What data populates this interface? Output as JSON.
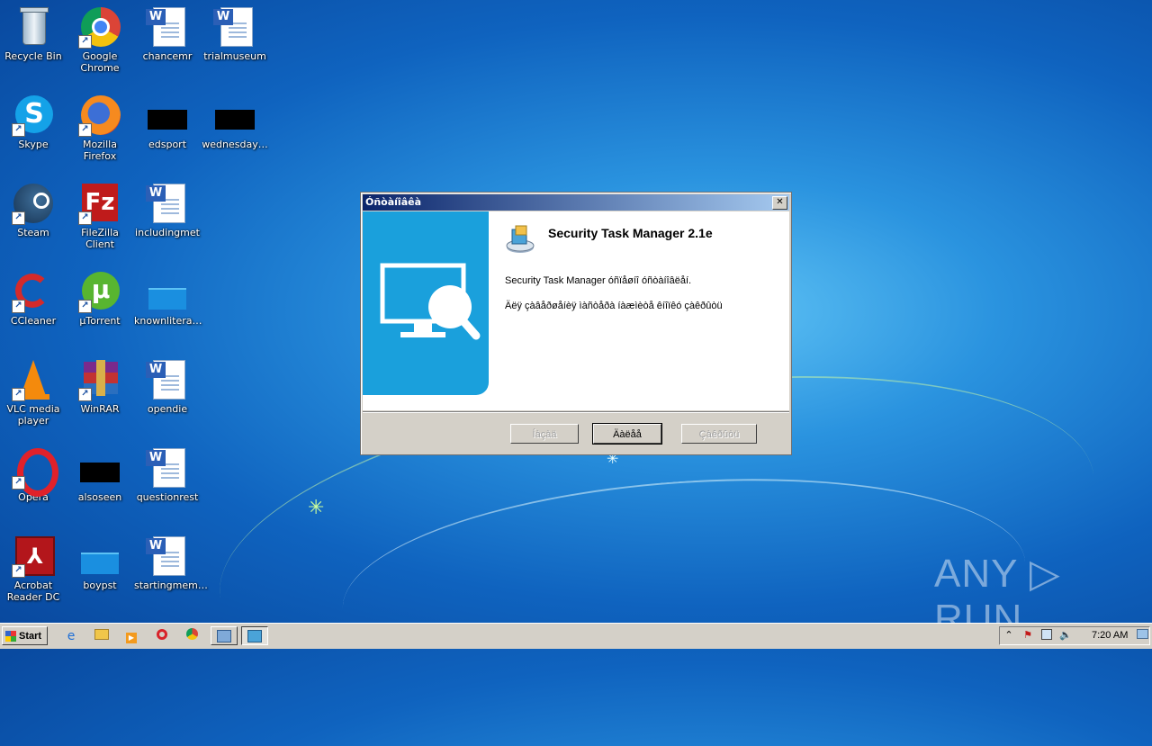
{
  "desktop": {
    "icons": [
      {
        "label": "Recycle Bin"
      },
      {
        "label": "Google Chrome"
      },
      {
        "label": "chancemr"
      },
      {
        "label": "trialmuseum"
      },
      {
        "label": "Skype"
      },
      {
        "label": "Mozilla Firefox"
      },
      {
        "label": "edsport"
      },
      {
        "label": "wednesday…"
      },
      {
        "label": "Steam"
      },
      {
        "label": "FileZilla Client"
      },
      {
        "label": "includingmet"
      },
      {
        "label": "CCleaner"
      },
      {
        "label": "µTorrent"
      },
      {
        "label": "knownlitera…"
      },
      {
        "label": "VLC media player"
      },
      {
        "label": "WinRAR"
      },
      {
        "label": "opendie"
      },
      {
        "label": "Opera"
      },
      {
        "label": "alsoseen"
      },
      {
        "label": "questionrest"
      },
      {
        "label": "Acrobat Reader DC"
      },
      {
        "label": "boypst"
      },
      {
        "label": "startingmem…"
      }
    ]
  },
  "dialog": {
    "title": "Óñòàíîâêà",
    "close_glyph": "✕",
    "product_title": "Security Task Manager 2.1e",
    "message_line1": "Security Task Manager óñïåøíî óñòàíîâëåí.",
    "message_line2": "Äëÿ çàâåðøåíèÿ ìàñòåðà íàæìèòå êíîïêó çàêðûòü",
    "buttons": {
      "back": "Íàçàä",
      "next": "Äàëåå",
      "close": "Çàêðûòü"
    }
  },
  "watermark": "ANY ▷ RUN",
  "taskbar": {
    "start_label": "Start",
    "clock": "7:20 AM"
  },
  "colors": {
    "dialog_panel": "#1aa0dc",
    "titlebar_start": "#0a246a",
    "titlebar_end": "#a6caf0"
  }
}
